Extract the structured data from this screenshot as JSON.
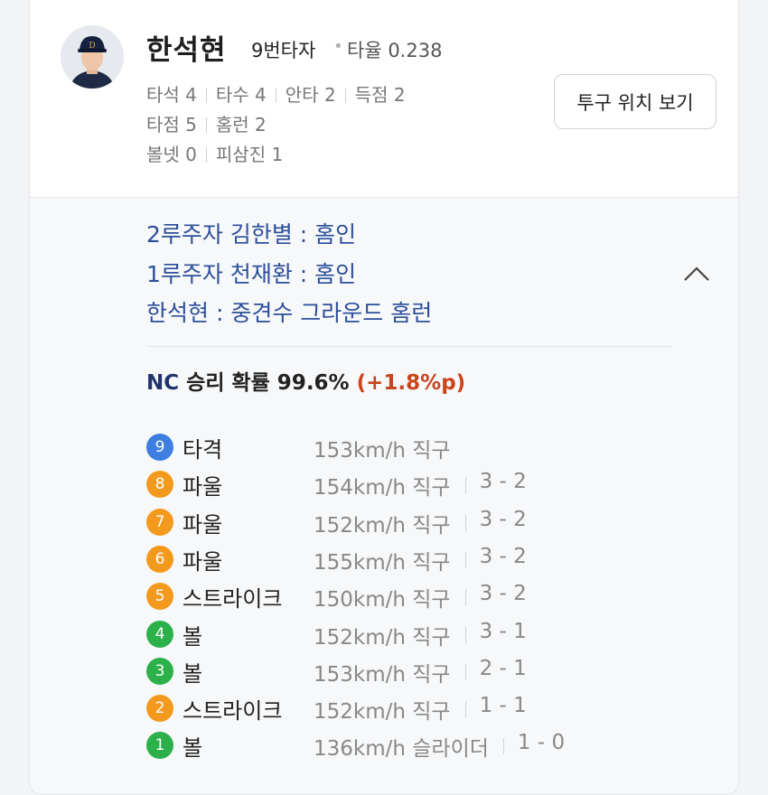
{
  "batter": {
    "name": "한석현",
    "order": "9번타자",
    "avg_label": "타율 0.238",
    "stat_lines": [
      [
        "타석 4",
        "타수 4",
        "안타 2",
        "득점 2"
      ],
      [
        "타점 5",
        "홈런 2"
      ],
      [
        "볼넷 0",
        "피삼진 1"
      ]
    ],
    "pitch_button": "투구 위치 보기"
  },
  "play": {
    "events": [
      "2루주자 김한별 : 홈인",
      "1루주자 천재환 : 홈인",
      "한석현 : 중견수 그라운드 홈런"
    ]
  },
  "win_prob": {
    "team": "NC",
    "label": "승리 확률 99.6%",
    "delta": "(+1.8%p)"
  },
  "pitches": [
    {
      "num": "9",
      "result": "타격",
      "speed": "153km/h",
      "type": "직구",
      "count": "",
      "color": "#3d7ee0"
    },
    {
      "num": "8",
      "result": "파울",
      "speed": "154km/h",
      "type": "직구",
      "count": "3 - 2",
      "color": "#f39a1e"
    },
    {
      "num": "7",
      "result": "파울",
      "speed": "152km/h",
      "type": "직구",
      "count": "3 - 2",
      "color": "#f39a1e"
    },
    {
      "num": "6",
      "result": "파울",
      "speed": "155km/h",
      "type": "직구",
      "count": "3 - 2",
      "color": "#f39a1e"
    },
    {
      "num": "5",
      "result": "스트라이크",
      "speed": "150km/h",
      "type": "직구",
      "count": "3 - 2",
      "color": "#f39a1e"
    },
    {
      "num": "4",
      "result": "볼",
      "speed": "152km/h",
      "type": "직구",
      "count": "3 - 1",
      "color": "#2cb14a"
    },
    {
      "num": "3",
      "result": "볼",
      "speed": "153km/h",
      "type": "직구",
      "count": "2 - 1",
      "color": "#2cb14a"
    },
    {
      "num": "2",
      "result": "스트라이크",
      "speed": "152km/h",
      "type": "직구",
      "count": "1 - 1",
      "color": "#f39a1e"
    },
    {
      "num": "1",
      "result": "볼",
      "speed": "136km/h",
      "type": "슬라이더",
      "count": "1 - 0",
      "color": "#2cb14a"
    }
  ]
}
